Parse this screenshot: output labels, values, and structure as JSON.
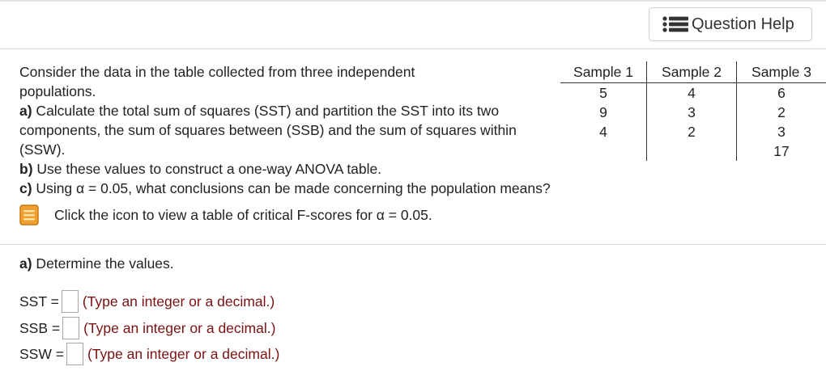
{
  "header": {
    "help_label": "Question Help",
    "help_icon": "list-icon"
  },
  "problem": {
    "intro": "Consider the data in the table collected from three independent populations.",
    "part_a_prefix": "a)",
    "part_a": " Calculate the total sum of squares (SST) and  partition the SST into its two components, the sum of squares between (SSB) and the sum of squares within (SSW).",
    "part_b_prefix": "b)",
    "part_b": " Use these values to construct a one-way ANOVA table.",
    "part_c_prefix": "c)",
    "part_c": " Using α = 0.05, what conclusions can be made concerning the population means?",
    "note": "Click the icon to view a table of critical F-scores for α = 0.05.",
    "note_icon": "book-icon"
  },
  "table": {
    "headers": [
      "Sample 1",
      "Sample 2",
      "Sample 3"
    ],
    "rows": [
      [
        "5",
        "4",
        "6"
      ],
      [
        "9",
        "3",
        "2"
      ],
      [
        "4",
        "2",
        "3"
      ],
      [
        "",
        "",
        "17"
      ]
    ]
  },
  "answers": {
    "heading_prefix": "a)",
    "heading": " Determine the values.",
    "fields": [
      {
        "label": "SST =",
        "hint": "(Type an integer or a decimal.)",
        "value": ""
      },
      {
        "label": "SSB =",
        "hint": "(Type an integer or a decimal.)",
        "value": ""
      },
      {
        "label": "SSW =",
        "hint": "(Type an integer or a decimal.)",
        "value": ""
      }
    ]
  },
  "colors": {
    "hint_text": "#7a1111",
    "book_icon": "#f0a030",
    "divider": "#dcdcdc"
  }
}
